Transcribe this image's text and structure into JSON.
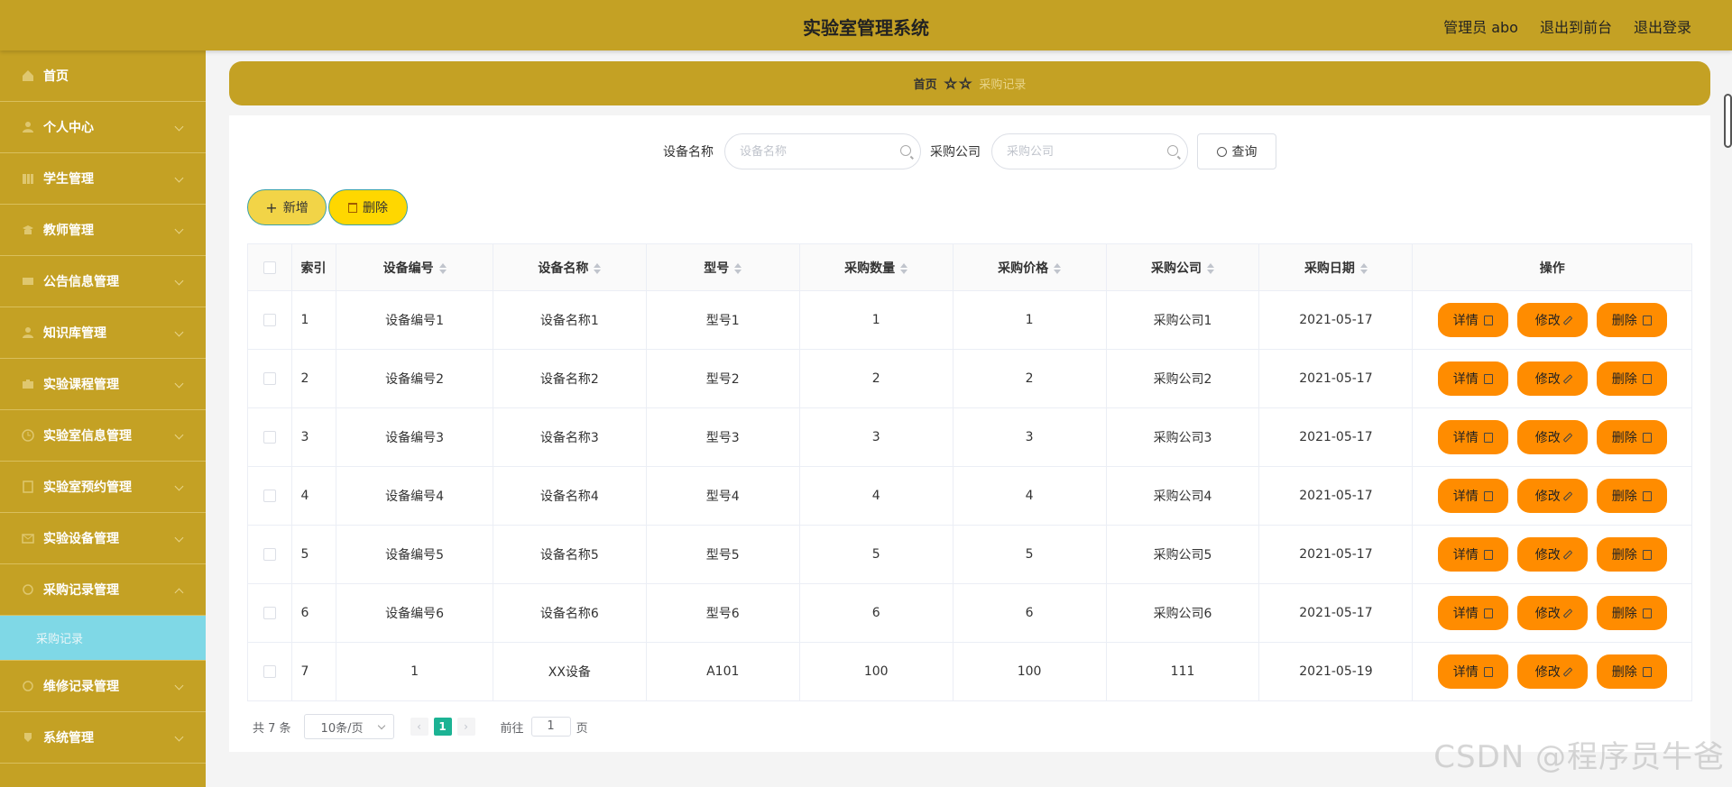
{
  "header": {
    "title": "实验室管理系统",
    "admin": "管理员 abo",
    "front": "退出到前台",
    "logout": "退出登录"
  },
  "sidebar": {
    "items": [
      {
        "label": "首页"
      },
      {
        "label": "个人中心"
      },
      {
        "label": "学生管理"
      },
      {
        "label": "教师管理"
      },
      {
        "label": "公告信息管理"
      },
      {
        "label": "知识库管理"
      },
      {
        "label": "实验课程管理"
      },
      {
        "label": "实验室信息管理"
      },
      {
        "label": "实验室预约管理"
      },
      {
        "label": "实验设备管理"
      },
      {
        "label": "采购记录管理"
      },
      {
        "label": "维修记录管理"
      },
      {
        "label": "系统管理"
      }
    ],
    "active_sub": "采购记录"
  },
  "breadcrumb": {
    "home": "首页",
    "current": "采购记录"
  },
  "search": {
    "name_label": "设备名称",
    "name_placeholder": "设备名称",
    "company_label": "采购公司",
    "company_placeholder": "采购公司",
    "query_label": "查询"
  },
  "toolbar": {
    "add_label": "新增",
    "delete_label": "删除"
  },
  "table": {
    "columns": [
      "索引",
      "设备编号",
      "设备名称",
      "型号",
      "采购数量",
      "采购价格",
      "采购公司",
      "采购日期",
      "操作"
    ],
    "rows": [
      [
        "1",
        "设备编号1",
        "设备名称1",
        "型号1",
        "1",
        "1",
        "采购公司1",
        "2021-05-17"
      ],
      [
        "2",
        "设备编号2",
        "设备名称2",
        "型号2",
        "2",
        "2",
        "采购公司2",
        "2021-05-17"
      ],
      [
        "3",
        "设备编号3",
        "设备名称3",
        "型号3",
        "3",
        "3",
        "采购公司3",
        "2021-05-17"
      ],
      [
        "4",
        "设备编号4",
        "设备名称4",
        "型号4",
        "4",
        "4",
        "采购公司4",
        "2021-05-17"
      ],
      [
        "5",
        "设备编号5",
        "设备名称5",
        "型号5",
        "5",
        "5",
        "采购公司5",
        "2021-05-17"
      ],
      [
        "6",
        "设备编号6",
        "设备名称6",
        "型号6",
        "6",
        "6",
        "采购公司6",
        "2021-05-17"
      ],
      [
        "7",
        "1",
        "XX设备",
        "A101",
        "100",
        "100",
        "111",
        "2021-05-19"
      ]
    ],
    "row_actions": {
      "detail": "详情",
      "edit": "修改",
      "delete": "删除"
    }
  },
  "pagination": {
    "total": "共 7 条",
    "page_size": "10条/页",
    "current_page": "1",
    "goto_prefix": "前往",
    "goto_value": "1",
    "goto_suffix": "页"
  },
  "watermark": "CSDN @程序员牛爸",
  "colors": {
    "brand": "#c4a124",
    "active_sub": "#7fd8e6",
    "action_button": "#ff8c00",
    "page_active": "#1cb394"
  }
}
